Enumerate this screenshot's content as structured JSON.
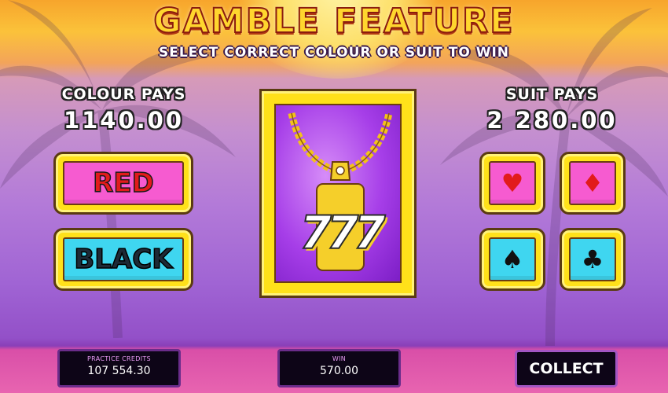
{
  "header": {
    "title": "GAMBLE FEATURE",
    "subtitle": "SELECT CORRECT COLOUR OR SUIT TO WIN"
  },
  "colour_pays": {
    "label": "COLOUR PAYS",
    "amount": "1140.00"
  },
  "suit_pays": {
    "label": "SUIT PAYS",
    "amount": "2 280.00"
  },
  "colour_buttons": {
    "red": "RED",
    "black": "BLACK"
  },
  "suit_buttons": {
    "hearts": "♥",
    "diamonds": "♦",
    "spades": "♠",
    "clubs": "♣"
  },
  "card": {
    "glyph": "777"
  },
  "bottom": {
    "credits_label": "PRACTICE CREDITS",
    "credits_value": "107 554.30",
    "win_label": "WIN",
    "win_value": "570.00",
    "collect_label": "COLLECT"
  },
  "colors": {
    "gold": "#ffe11a",
    "pink_button": "#f65bd0",
    "cyan_button": "#3fd6f0",
    "red_text": "#e21b1b",
    "panel_bg": "#0d0517"
  }
}
